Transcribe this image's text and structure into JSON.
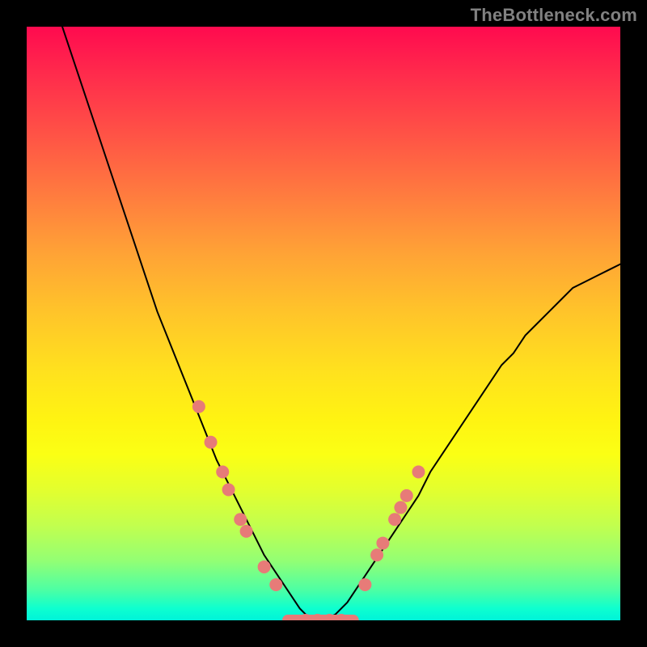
{
  "watermark": "TheBottleneck.com",
  "chart_data": {
    "type": "line",
    "title": "",
    "xlabel": "",
    "ylabel": "",
    "xlim": [
      0,
      100
    ],
    "ylim": [
      0,
      100
    ],
    "grid": false,
    "series": [
      {
        "name": "bottleneck-curve",
        "note": "V-shaped black curve; left branch steep from near top-left, min near x≈47 at y≈0, right branch rises concave to ~y≈60 at right edge",
        "x": [
          6,
          8,
          10,
          12,
          14,
          16,
          18,
          20,
          22,
          24,
          26,
          28,
          30,
          32,
          34,
          36,
          38,
          40,
          42,
          44,
          46,
          48,
          50,
          52,
          54,
          56,
          58,
          60,
          62,
          64,
          66,
          68,
          70,
          72,
          74,
          76,
          78,
          80,
          82,
          84,
          86,
          88,
          90,
          92,
          94,
          96,
          98,
          100
        ],
        "values": [
          100,
          94,
          88,
          82,
          76,
          70,
          64,
          58,
          52,
          47,
          42,
          37,
          32,
          27,
          23,
          19,
          15,
          11,
          8,
          5,
          2,
          0,
          0,
          1,
          3,
          6,
          9,
          12,
          15,
          18,
          21,
          25,
          28,
          31,
          34,
          37,
          40,
          43,
          45,
          48,
          50,
          52,
          54,
          56,
          57,
          58,
          59,
          60
        ]
      }
    ],
    "markers": {
      "name": "highlight-dots",
      "color": "#e77b78",
      "radius_px": 8,
      "note": "salmon circular markers along lower parts of both branches; flat segment between them",
      "points": [
        {
          "x": 29,
          "y": 36
        },
        {
          "x": 31,
          "y": 30
        },
        {
          "x": 33,
          "y": 25
        },
        {
          "x": 34,
          "y": 22
        },
        {
          "x": 36,
          "y": 17
        },
        {
          "x": 37,
          "y": 15
        },
        {
          "x": 40,
          "y": 9
        },
        {
          "x": 42,
          "y": 6
        },
        {
          "x": 47,
          "y": 0
        },
        {
          "x": 49,
          "y": 0
        },
        {
          "x": 51,
          "y": 0
        },
        {
          "x": 53,
          "y": 0
        },
        {
          "x": 57,
          "y": 6
        },
        {
          "x": 59,
          "y": 11
        },
        {
          "x": 60,
          "y": 13
        },
        {
          "x": 62,
          "y": 17
        },
        {
          "x": 63,
          "y": 19
        },
        {
          "x": 64,
          "y": 21
        },
        {
          "x": 66,
          "y": 25
        }
      ],
      "flat_segment": {
        "x_start": 44,
        "x_end": 55,
        "y": 0,
        "thickness_px": 14
      }
    },
    "colors": {
      "curve": "#000000",
      "markers": "#e77b78",
      "background_border": "#000000"
    }
  }
}
